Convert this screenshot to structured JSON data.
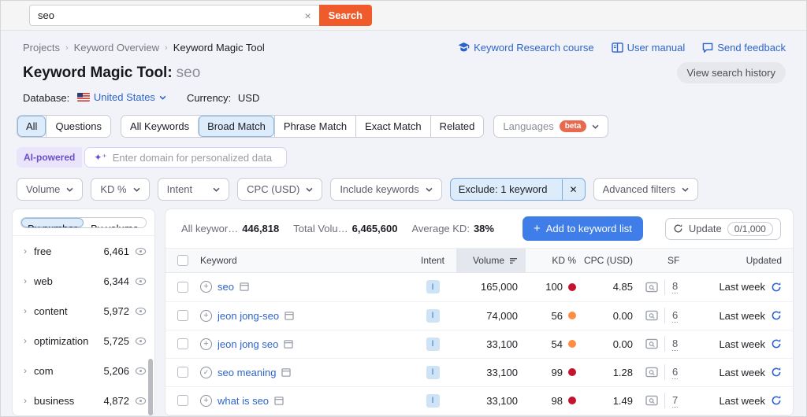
{
  "topbar": {
    "search_value": "seo",
    "search_button": "Search",
    "clear_icon": "x"
  },
  "breadcrumb": {
    "items": [
      "Projects",
      "Keyword Overview",
      "Keyword Magic Tool"
    ]
  },
  "header_links": [
    {
      "icon": "graduation-cap-icon",
      "label": "Keyword Research course"
    },
    {
      "icon": "book-icon",
      "label": "User manual"
    },
    {
      "icon": "feedback-bubble-icon",
      "label": "Send feedback"
    }
  ],
  "page": {
    "title": "Keyword Magic Tool:",
    "title_query": "seo",
    "view_history_button": "View search history",
    "database_label": "Database:",
    "database_value": "United States",
    "currency_label": "Currency:",
    "currency_value": "USD"
  },
  "tabs": {
    "primary": [
      {
        "label": "All",
        "selected": true
      },
      {
        "label": "Questions",
        "selected": false
      }
    ],
    "match": [
      {
        "label": "All Keywords",
        "selected": false
      },
      {
        "label": "Broad Match",
        "selected": true
      },
      {
        "label": "Phrase Match",
        "selected": false
      },
      {
        "label": "Exact Match",
        "selected": false
      },
      {
        "label": "Related",
        "selected": false
      }
    ],
    "languages": {
      "label": "Languages",
      "badge": "beta"
    }
  },
  "ai_bar": {
    "badge": "AI-powered",
    "sparkle_icon": "sparkles",
    "placeholder": "Enter domain for personalized data"
  },
  "filters": {
    "volume": "Volume",
    "kd": "KD %",
    "intent": "Intent",
    "cpc": "CPC (USD)",
    "include": "Include keywords",
    "exclude": "Exclude: 1 keyword",
    "exclude_close": "✕",
    "advanced": "Advanced filters"
  },
  "sidebar": {
    "toggle": [
      {
        "label": "By number",
        "selected": true
      },
      {
        "label": "By volume",
        "selected": false
      }
    ],
    "groups": [
      {
        "label": "free",
        "count": "6,461"
      },
      {
        "label": "web",
        "count": "6,344"
      },
      {
        "label": "content",
        "count": "5,972"
      },
      {
        "label": "optimization",
        "count": "5,725"
      },
      {
        "label": "com",
        "count": "5,206"
      },
      {
        "label": "business",
        "count": "4,872"
      }
    ]
  },
  "table": {
    "stats": {
      "all_keywords_label": "All keywor…",
      "all_keywords_value": "446,818",
      "total_volume_label": "Total Volu…",
      "total_volume_value": "6,465,600",
      "avg_kd_label": "Average KD:",
      "avg_kd_value": "38%"
    },
    "actions": {
      "add_plus": "+",
      "add_label": "Add to keyword list",
      "update_label": "Update",
      "update_quota": "0/1,000"
    },
    "columns": {
      "keyword": "Keyword",
      "intent": "Intent",
      "volume": "Volume",
      "kd": "KD %",
      "cpc": "CPC (USD)",
      "sf": "SF",
      "updated": "Updated"
    },
    "rows": [
      {
        "keyword": "seo",
        "add_state": "plus",
        "intent": "I",
        "volume": "165,000",
        "kd": "100",
        "kd_color": "red",
        "cpc": "4.85",
        "sf": "8",
        "updated": "Last week"
      },
      {
        "keyword": "jeon jong-seo",
        "add_state": "plus",
        "intent": "I",
        "volume": "74,000",
        "kd": "56",
        "kd_color": "orange",
        "cpc": "0.00",
        "sf": "6",
        "updated": "Last week"
      },
      {
        "keyword": "jeon jong seo",
        "add_state": "plus",
        "intent": "I",
        "volume": "33,100",
        "kd": "54",
        "kd_color": "orange",
        "cpc": "0.00",
        "sf": "8",
        "updated": "Last week"
      },
      {
        "keyword": "seo meaning",
        "add_state": "check",
        "intent": "I",
        "volume": "33,100",
        "kd": "99",
        "kd_color": "red",
        "cpc": "1.28",
        "sf": "6",
        "updated": "Last week"
      },
      {
        "keyword": "what is seo",
        "add_state": "plus",
        "intent": "I",
        "volume": "33,100",
        "kd": "98",
        "kd_color": "red",
        "cpc": "1.49",
        "sf": "7",
        "updated": "Last week"
      }
    ]
  },
  "colors": {
    "brand_orange": "#ef5b2b",
    "beta_orange": "#e9694e",
    "link_blue": "#2d64ca",
    "primary_button_blue": "#3f7ee8",
    "selected_tab_blue": "#dcecfb",
    "kd_red": "#c4132c",
    "kd_orange": "#ff8c43",
    "ai_purple": "#6a4fc9"
  }
}
